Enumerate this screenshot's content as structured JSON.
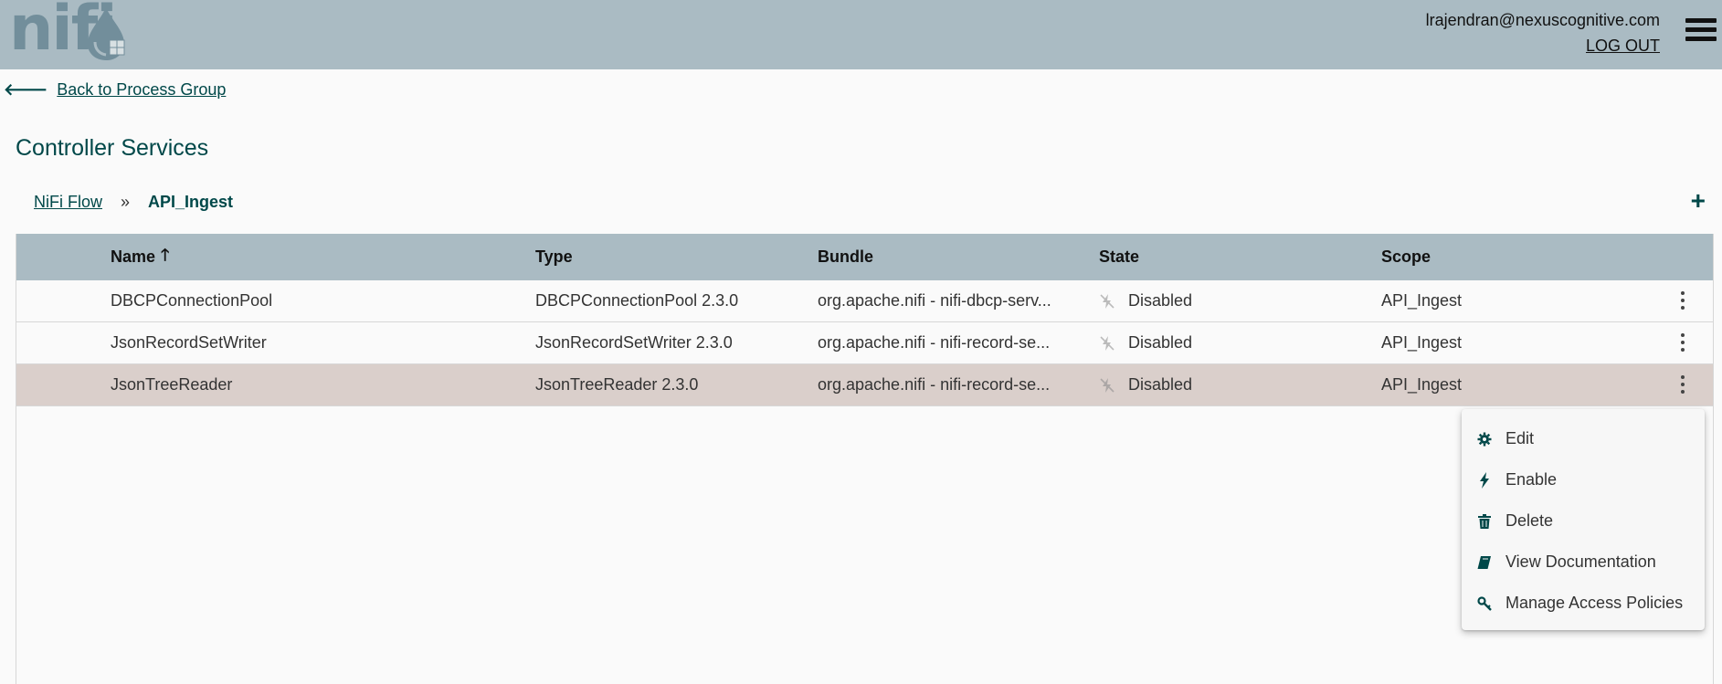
{
  "header": {
    "logo_text": "nifi",
    "user_email": "lrajendran@nexuscognitive.com",
    "logout_label": "LOG OUT"
  },
  "nav": {
    "back_label": "Back to Process Group"
  },
  "page": {
    "title": "Controller Services"
  },
  "breadcrumb": {
    "root": "NiFi Flow",
    "separator": "»",
    "current": "API_Ingest"
  },
  "table": {
    "columns": {
      "name": "Name",
      "type": "Type",
      "bundle": "Bundle",
      "state": "State",
      "scope": "Scope"
    },
    "sort": {
      "column": "name",
      "direction": "ascending"
    },
    "rows": [
      {
        "name": "DBCPConnectionPool",
        "type": "DBCPConnectionPool 2.3.0",
        "bundle": "org.apache.nifi - nifi-dbcp-serv...",
        "state": "Disabled",
        "scope": "API_Ingest",
        "selected": false
      },
      {
        "name": "JsonRecordSetWriter",
        "type": "JsonRecordSetWriter 2.3.0",
        "bundle": "org.apache.nifi - nifi-record-se...",
        "state": "Disabled",
        "scope": "API_Ingest",
        "selected": false
      },
      {
        "name": "JsonTreeReader",
        "type": "JsonTreeReader 2.3.0",
        "bundle": "org.apache.nifi - nifi-record-se...",
        "state": "Disabled",
        "scope": "API_Ingest",
        "selected": true
      }
    ]
  },
  "context_menu": {
    "items": [
      {
        "label": "Edit",
        "icon": "gear-icon"
      },
      {
        "label": "Enable",
        "icon": "lightning-icon"
      },
      {
        "label": "Delete",
        "icon": "trash-icon"
      },
      {
        "label": "View Documentation",
        "icon": "book-icon"
      },
      {
        "label": "Manage Access Policies",
        "icon": "key-icon"
      }
    ]
  },
  "colors": {
    "header_bg": "#aabbc3",
    "accent": "#004849",
    "selected_row": "#dacfcb",
    "logo": "#728e9b"
  }
}
